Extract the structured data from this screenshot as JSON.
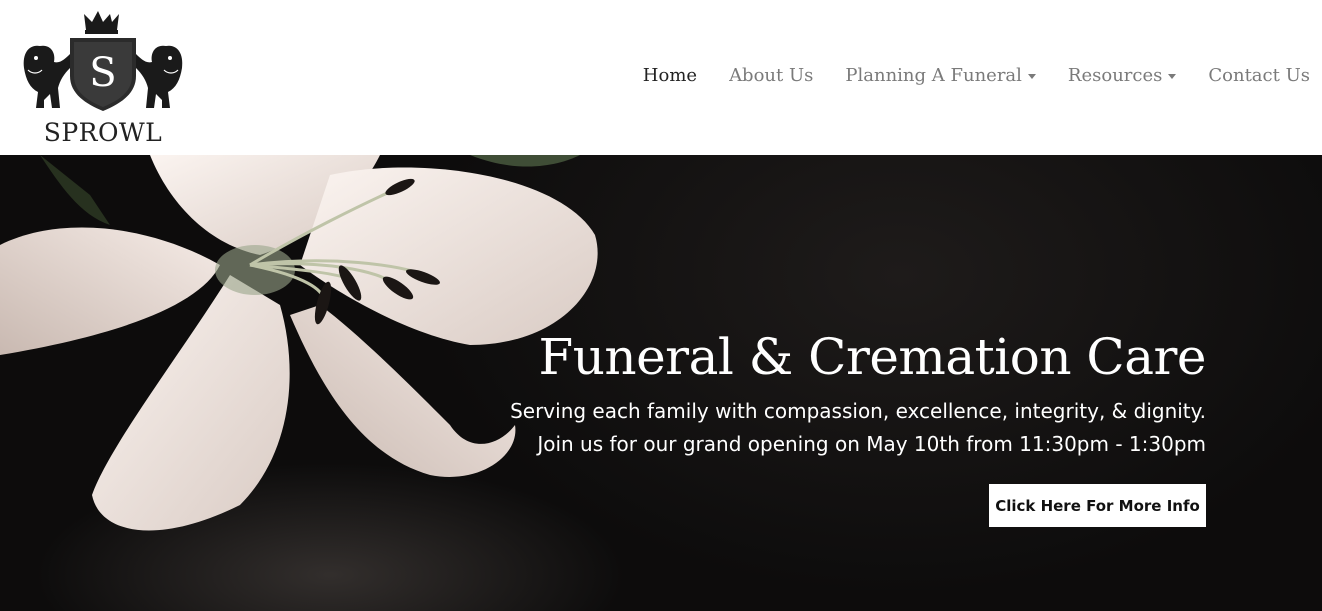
{
  "brand": {
    "logo_letter": "S",
    "logo_text": "SPROWL"
  },
  "nav": {
    "items": [
      {
        "label": "Home",
        "active": true,
        "dropdown": false
      },
      {
        "label": "About Us",
        "active": false,
        "dropdown": false
      },
      {
        "label": "Planning A Funeral",
        "active": false,
        "dropdown": true
      },
      {
        "label": "Resources",
        "active": false,
        "dropdown": true
      },
      {
        "label": "Contact Us",
        "active": false,
        "dropdown": false
      }
    ]
  },
  "hero": {
    "title": "Funeral & Cremation Care",
    "line1": "Serving each family with compassion, excellence, integrity, & dignity.",
    "line2": "Join us for our grand opening on May 10th from 11:30pm - 1:30pm",
    "cta_label": "Click Here For More Info"
  },
  "colors": {
    "nav_text": "#7a7a7a",
    "nav_active": "#222222",
    "hero_bg": "#121010",
    "petal": "#f3e9e4"
  },
  "icons": [
    "crown-icon",
    "lion-left-icon",
    "lion-right-icon",
    "shield-icon",
    "caret-down-icon"
  ]
}
